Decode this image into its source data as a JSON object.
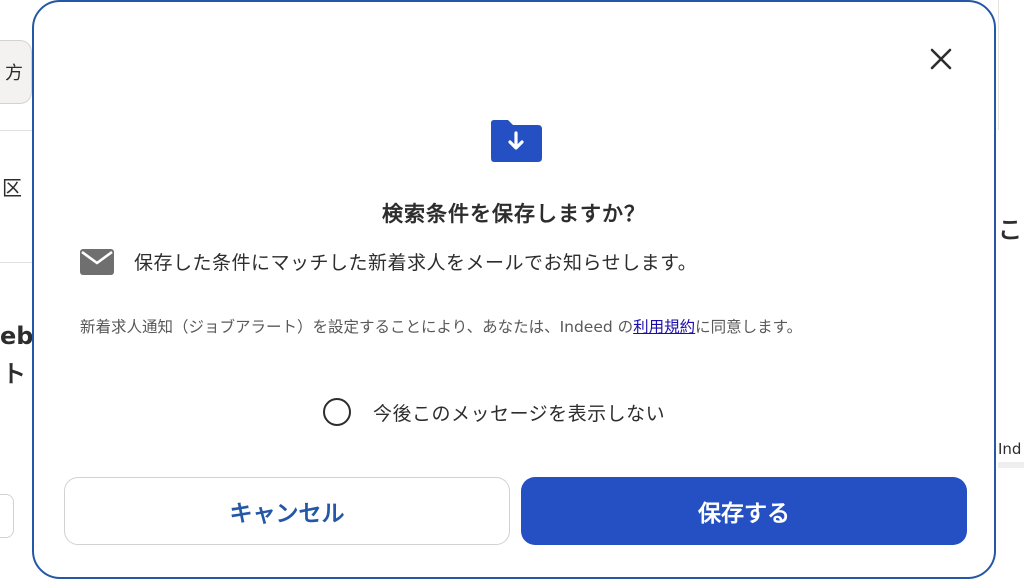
{
  "colors": {
    "primary": "#2450c4",
    "modal_border": "#2557a7",
    "link": "#1a0dab",
    "icon_gray": "#767676",
    "folder_blue": "#2450c4"
  },
  "background": {
    "pill_text": "方",
    "left_text_1": "区",
    "left_text_2": "eb",
    "left_text_3": "ト",
    "right_text_1": "こ",
    "right_text_2": "Ind"
  },
  "dialog": {
    "icon": "folder-download-icon",
    "close_icon": "close-icon",
    "title": "検索条件を保存しますか？",
    "mail_icon": "mail-icon",
    "mail_text": "保存した条件にマッチした新着求人をメールでお知らせします。",
    "terms_before": "新着求人通知（ジョブアラート）を設定することにより、あなたは、Indeed の",
    "terms_link": "利用規約",
    "terms_after": "に同意します。",
    "checkbox_label": "今後このメッセージを表示しない",
    "checkbox_checked": false,
    "cancel_label": "キャンセル",
    "save_label": "保存する"
  }
}
